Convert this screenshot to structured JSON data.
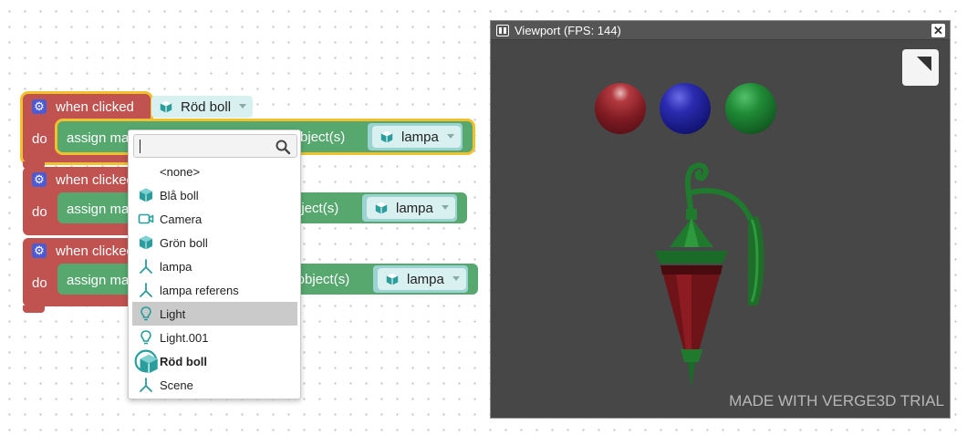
{
  "workspace": {
    "blocks": [
      {
        "event_label": "when clicked",
        "do_label": "do",
        "gear_icon": "gear-icon",
        "action_label": "assign material",
        "target_prefix": "to object(s)",
        "target_value": "lampa"
      },
      {
        "event_label": "when clicked",
        "do_label": "do",
        "gear_icon": "gear-icon",
        "action_label": "assign material",
        "target_prefix": "to object(s)",
        "target_value": "lampa"
      },
      {
        "event_label": "when clicked",
        "do_label": "do",
        "gear_icon": "gear-icon",
        "action_label": "assign material",
        "target_prefix": "to object(s)",
        "target_value": "lampa"
      }
    ],
    "selected_object": "Röd boll"
  },
  "dropdown": {
    "search_value": "",
    "search_icon": "magnifier-icon",
    "items": [
      {
        "label": "<none>",
        "icon": ""
      },
      {
        "label": "Blå boll",
        "icon": "mesh-cube-icon"
      },
      {
        "label": "Camera",
        "icon": "camera-icon"
      },
      {
        "label": "Grön boll",
        "icon": "mesh-cube-icon"
      },
      {
        "label": "lampa",
        "icon": "empty-axes-icon"
      },
      {
        "label": "lampa referens",
        "icon": "empty-axes-icon"
      },
      {
        "label": "Light",
        "icon": "lightbulb-icon",
        "highlighted": true
      },
      {
        "label": "Light.001",
        "icon": "lightbulb-icon"
      },
      {
        "label": "Röd boll",
        "icon": "mesh-cube-icon",
        "selected": true
      },
      {
        "label": "Scene",
        "icon": "empty-axes-icon"
      }
    ]
  },
  "viewport": {
    "title": "Viewport (FPS: 144)",
    "close_label": "✕",
    "watermark": "MADE WITH VERGE3D TRIAL",
    "balls": [
      {
        "name": "red-ball",
        "color": "#8a1f24"
      },
      {
        "name": "blue-ball",
        "color": "#1e1f8e"
      },
      {
        "name": "green-ball",
        "color": "#17702a"
      }
    ]
  },
  "colors": {
    "event_block": "#c0524f",
    "action_block": "#56a86f",
    "field_bg": "#d9f0f0",
    "selection": "#f0c02e",
    "icon_teal": "#2a9d9d"
  }
}
